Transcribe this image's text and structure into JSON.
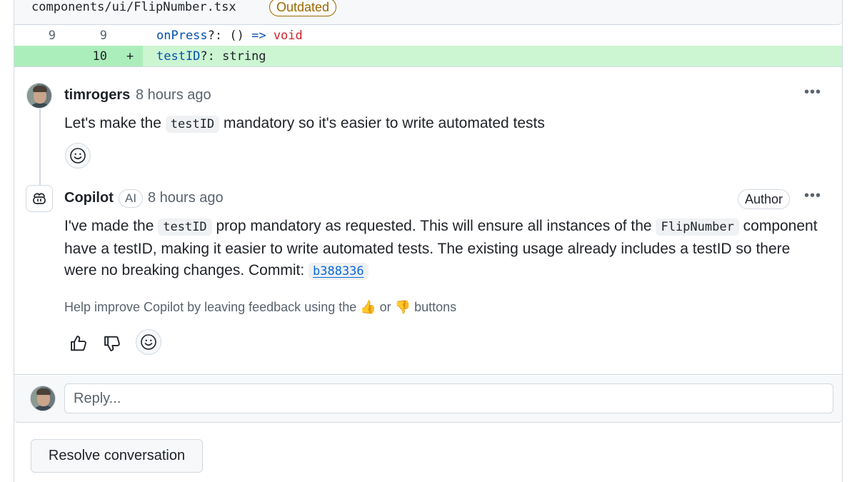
{
  "file": {
    "path": "components/ui/FlipNumber.tsx",
    "status_badge": "Outdated"
  },
  "diff": {
    "context_line": {
      "old_num": "9",
      "new_num": "9",
      "prop": "onPress",
      "mid": "?: () ",
      "arrow": "=>",
      "type": "void"
    },
    "added_line": {
      "new_num": "10",
      "sign": "+",
      "prop": "testID",
      "rest": "?: string"
    },
    "colors": {
      "added_bg": "#ccf5d2",
      "added_gutter": "#aceebb"
    }
  },
  "comments": [
    {
      "author": "timrogers",
      "time": "8 hours ago",
      "text_before": "Let's make the ",
      "code": "testID",
      "text_after": " mandatory so it's easier to write automated tests",
      "avatar_icon": "user-avatar",
      "more_icon": "kebab-horizontal-icon"
    },
    {
      "author": "Copilot",
      "ai_badge": "AI",
      "time": "8 hours ago",
      "role_badge": "Author",
      "text_1": "I've made the ",
      "code_1": "testID",
      "text_2": " prop mandatory as requested. This will ensure all instances of the ",
      "code_2": "FlipNumber",
      "text_3": " component have a testID, making it easier to write automated tests. The existing usage already includes a testID so there were no breaking changes. Commit: ",
      "commit_sha": "b388336",
      "helper_before": "Help improve Copilot by leaving feedback using the ",
      "thumbs_up_emoji": "👍",
      "helper_or": " or ",
      "thumbs_down_emoji": "👎",
      "helper_after": " buttons",
      "avatar_icon": "copilot-icon"
    }
  ],
  "reply": {
    "placeholder": "Reply..."
  },
  "actions": {
    "resolve_label": "Resolve conversation"
  },
  "accent": {
    "link": "#0969da",
    "outdated": "#9a6700"
  }
}
